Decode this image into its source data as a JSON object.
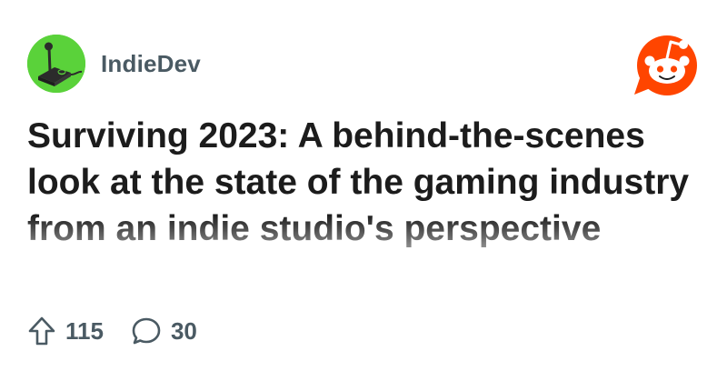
{
  "community": {
    "name": "IndieDev",
    "avatar_icon": "joystick-icon",
    "avatar_color": "#5ad23a"
  },
  "brand": {
    "logo_icon": "reddit-snoo-icon",
    "color": "#ff4500"
  },
  "post": {
    "title": "Surviving 2023: A behind-the-scenes look at the state of the gaming industry from an indie studio's perspective"
  },
  "stats": {
    "upvote_icon": "upvote-arrow-icon",
    "upvotes": "115",
    "comment_icon": "comment-bubble-icon",
    "comments": "30"
  }
}
